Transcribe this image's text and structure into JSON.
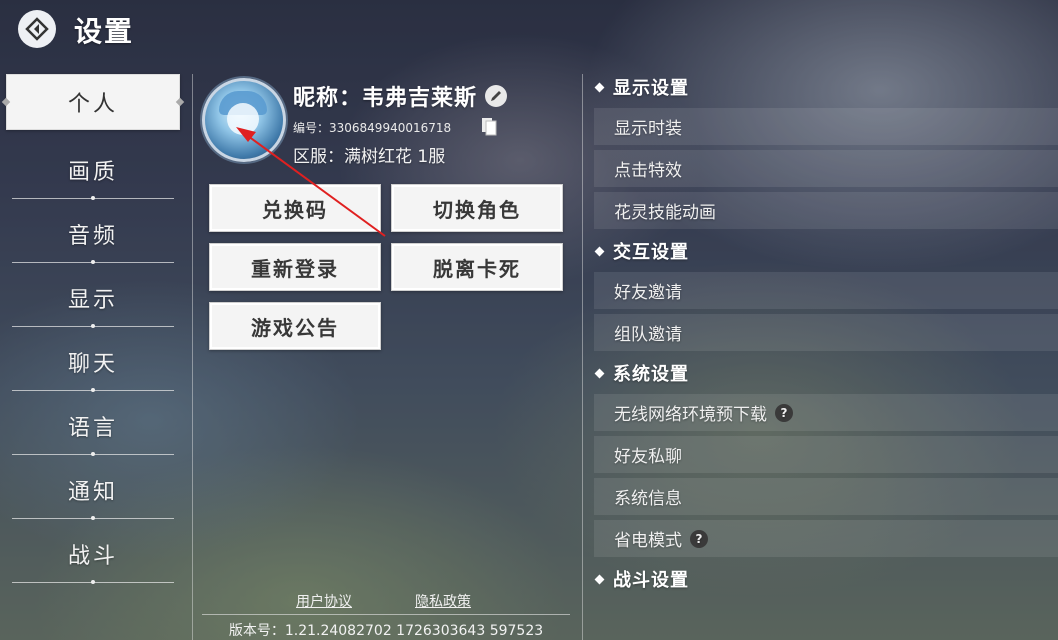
{
  "header": {
    "title": "设置"
  },
  "nav": {
    "items": [
      {
        "label": "个人"
      },
      {
        "label": "画质"
      },
      {
        "label": "音频"
      },
      {
        "label": "显示"
      },
      {
        "label": "聊天"
      },
      {
        "label": "语言"
      },
      {
        "label": "通知"
      },
      {
        "label": "战斗"
      }
    ],
    "active_index": 0
  },
  "profile": {
    "nickname": "昵称：韦弗吉莱斯",
    "uid": "编号：3306849940016718",
    "server": "区服：满树红花 1服"
  },
  "actions": {
    "redeem": "兑换码",
    "switch_role": "切换角色",
    "relogin": "重新登录",
    "unstuck": "脱离卡死",
    "announcement": "游戏公告"
  },
  "footer": {
    "user_agreement": "用户协议",
    "privacy_policy": "隐私政策",
    "version": "版本号：1.21.24082702 1726303643 597523"
  },
  "settings": {
    "display": {
      "title": "显示设置",
      "items": [
        "显示时装",
        "点击特效",
        "花灵技能动画"
      ]
    },
    "interaction": {
      "title": "交互设置",
      "items": [
        "好友邀请",
        "组队邀请"
      ]
    },
    "system": {
      "title": "系统设置",
      "items": [
        "无线网络环境预下载",
        "好友私聊",
        "系统信息",
        "省电模式"
      ]
    },
    "battle": {
      "title": "战斗设置"
    }
  },
  "annotation": {
    "color": "#e02020"
  }
}
